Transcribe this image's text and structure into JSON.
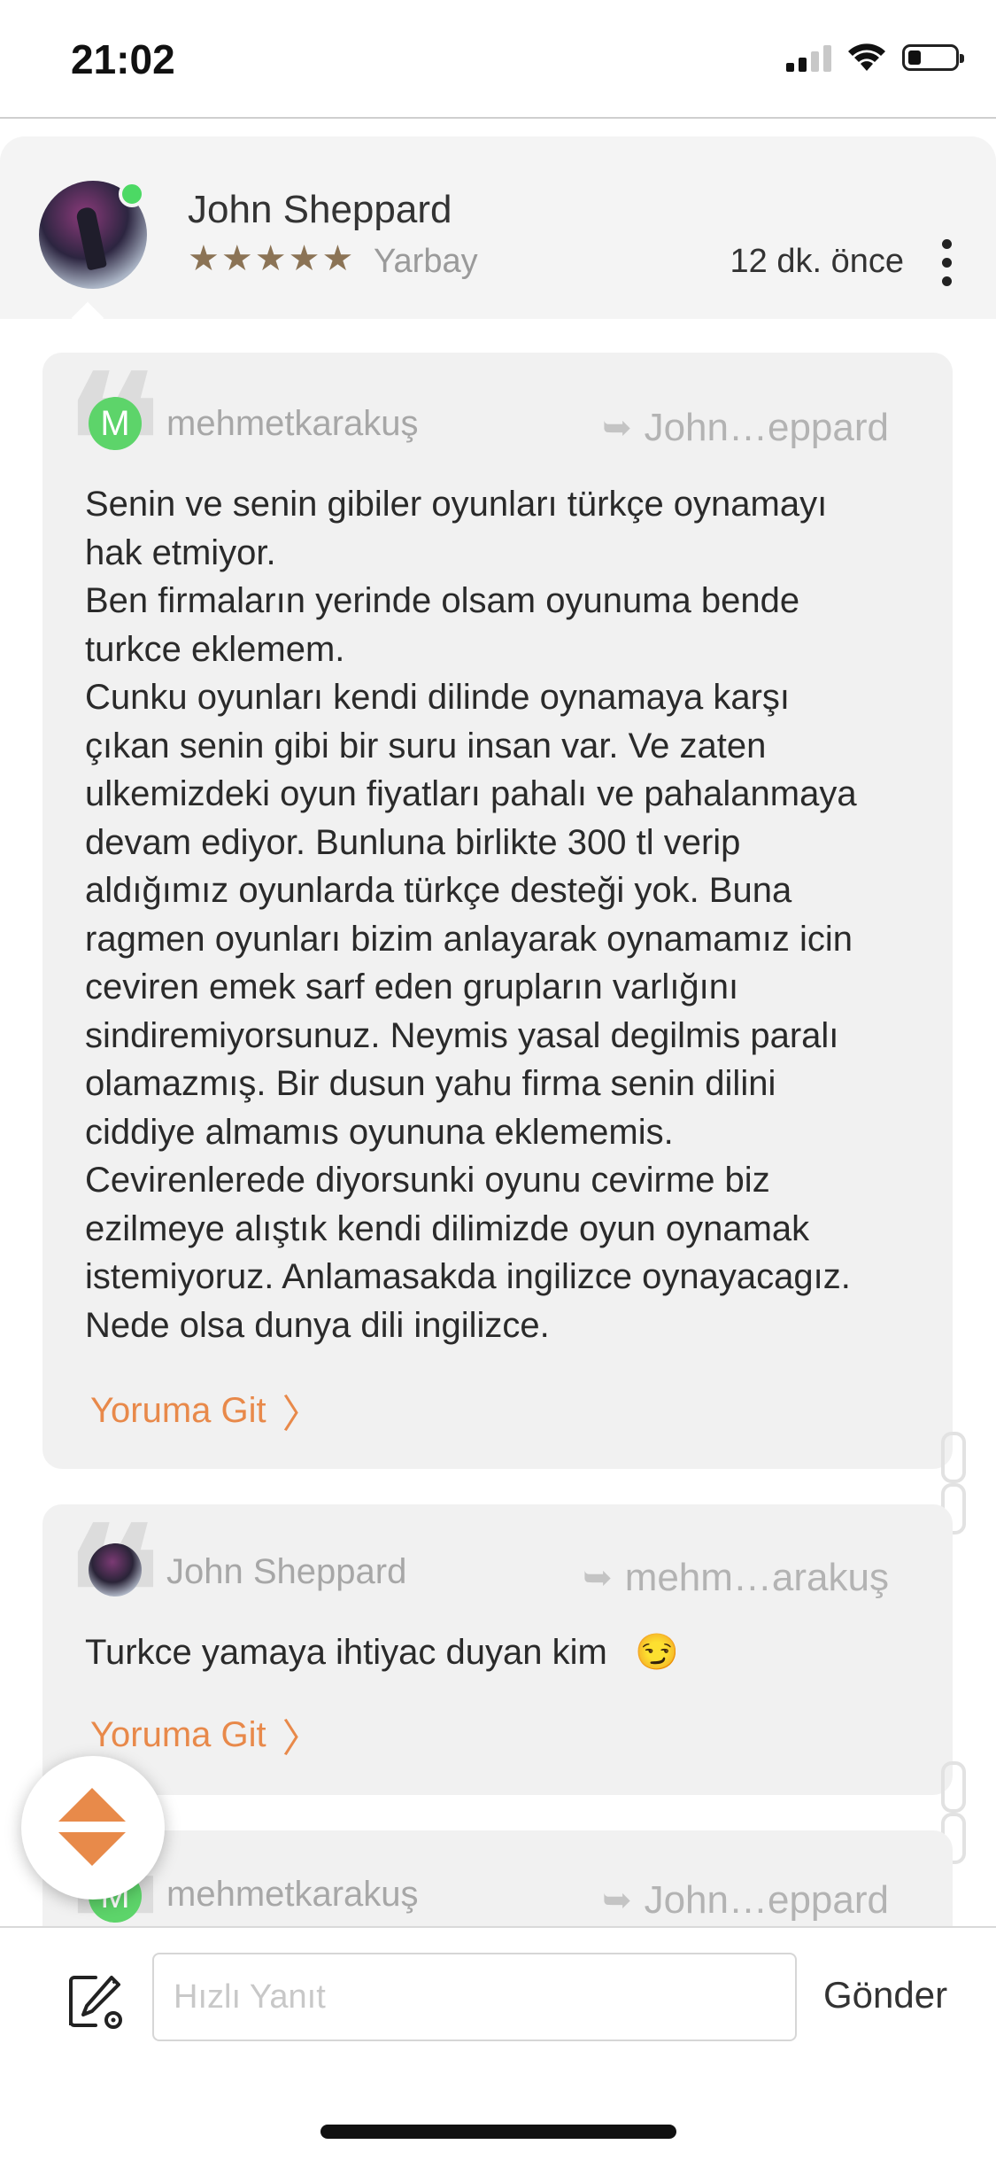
{
  "status_bar": {
    "time": "21:02"
  },
  "post": {
    "author": "John Sheppard",
    "rank": "Yarbay",
    "rating_stars": 5,
    "time_ago": "12 dk. önce",
    "online": true
  },
  "quotes": [
    {
      "author": "mehmetkarakuş",
      "avatar_letter": "M",
      "reply_to": "John…eppard",
      "go_label": "Yoruma Git",
      "text_lines": [
        "Senin ve senin gibiler oyunları türkçe oynamayı",
        "hak etmiyor.",
        "Ben firmaların yerinde olsam oyunuma bende",
        "turkce eklemem.",
        "Cunku oyunları kendi dilinde oynamaya karşı",
        "çıkan senin gibi bir suru insan var. Ve zaten",
        "ulkemizdeki oyun fiyatları pahalı ve pahalanmaya",
        "devam ediyor. Bunluna birlikte 300 tl verip",
        "aldığımız oyunlarda türkçe desteği yok. Buna",
        "ragmen oyunları bizim anlayarak oynamamız icin",
        "ceviren emek sarf eden grupların varlığını",
        "sindiremiyorsunuz. Neymis yasal degilmis paralı",
        "olamazmış. Bir dusun yahu firma senin dilini",
        "ciddiye almamıs oyununa eklememis.",
        "Cevirenlerede diyorsunki oyunu cevirme biz",
        "ezilmeye alıştık kendi dilimizde oyun oynamak",
        "istemiyoruz. Anlamasakda ingilizce oynayacagız.",
        "Nede olsa dunya dili ingilizce."
      ]
    },
    {
      "author": "John Sheppard",
      "reply_to": "mehm…arakuş",
      "go_label": "Yoruma Git",
      "text": "Turkce yamaya ihtiyac duyan kim",
      "emoji": "😏"
    },
    {
      "author": "mehmetkarakuş",
      "avatar_letter": "M",
      "reply_to": "John…eppard"
    }
  ],
  "reply_bar": {
    "placeholder": "Hızlı Yanıt",
    "value": "",
    "send_label": "Gönder"
  },
  "icons": {
    "compose": "edit-settings-icon",
    "reply_arrow": "reply-arrow-icon",
    "scroll": "scroll-up-down-icon",
    "more": "more-vertical-icon"
  },
  "colors": {
    "accent": "#e8894a",
    "online": "#4cd964",
    "stars": "#8b7355",
    "quote_bg": "#f1f1f1"
  }
}
